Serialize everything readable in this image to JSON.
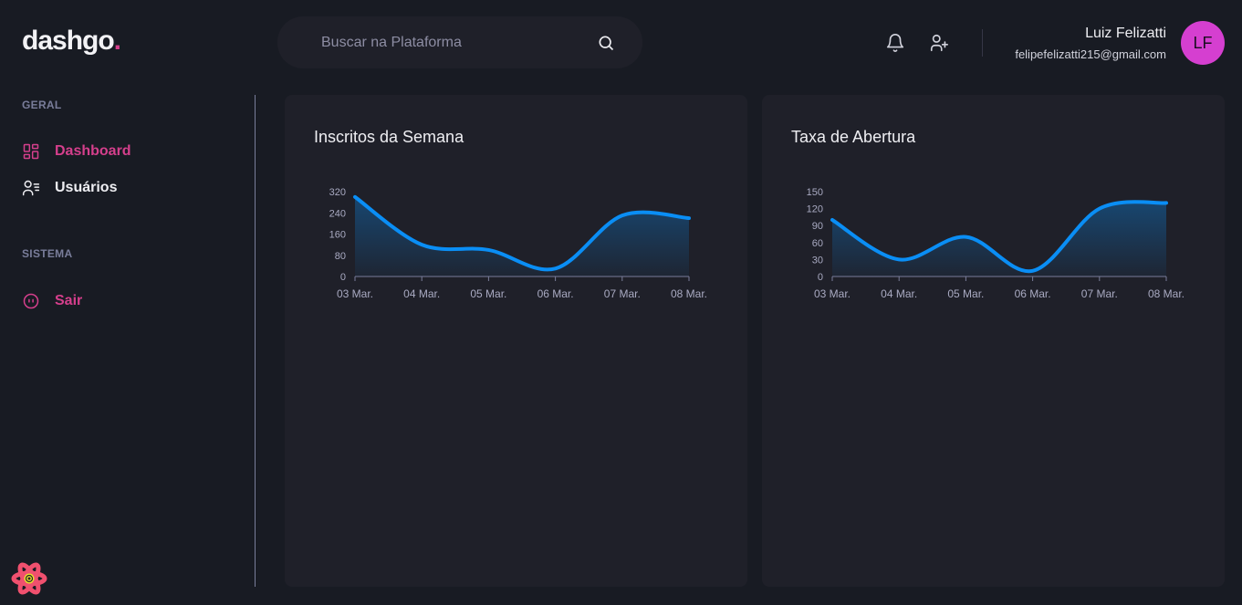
{
  "brand": {
    "name": "dashgo",
    "dot": "."
  },
  "search": {
    "placeholder": "Buscar na Plataforma"
  },
  "user": {
    "name": "Luiz Felizatti",
    "email": "felipefelizatti215@gmail.com",
    "initials": "LF"
  },
  "sidebar": {
    "sections": [
      {
        "title": "GERAL",
        "items": [
          {
            "label": "Dashboard",
            "icon": "dashboard-icon",
            "active": true
          },
          {
            "label": "Usuários",
            "icon": "users-icon",
            "active": false
          }
        ]
      },
      {
        "title": "SISTEMA",
        "items": [
          {
            "label": "Sair",
            "icon": "logout-icon",
            "active": true
          }
        ]
      }
    ]
  },
  "colors": {
    "accent": "#D53F8C",
    "line": "#0A8EF5",
    "background": "#181B23",
    "card": "#1F2029"
  },
  "cards": [
    {
      "title": "Inscritos da Semana"
    },
    {
      "title": "Taxa de Abertura"
    }
  ],
  "chart_data": [
    {
      "type": "area",
      "title": "Inscritos da Semana",
      "categories": [
        "03 Mar.",
        "04 Mar.",
        "05 Mar.",
        "06 Mar.",
        "07 Mar.",
        "08 Mar."
      ],
      "x": [
        "03 Mar.",
        "04 Mar.",
        "05 Mar.",
        "06 Mar.",
        "07 Mar.",
        "08 Mar."
      ],
      "values": [
        300,
        120,
        100,
        30,
        230,
        220
      ],
      "yticks": [
        0,
        80,
        160,
        240,
        320
      ],
      "ylim": [
        0,
        320
      ],
      "grid": false,
      "xlabel": "",
      "ylabel": ""
    },
    {
      "type": "area",
      "title": "Taxa de Abertura",
      "categories": [
        "03 Mar.",
        "04 Mar.",
        "05 Mar.",
        "06 Mar.",
        "07 Mar.",
        "08 Mar."
      ],
      "x": [
        "03 Mar.",
        "04 Mar.",
        "05 Mar.",
        "06 Mar.",
        "07 Mar.",
        "08 Mar."
      ],
      "values": [
        100,
        30,
        70,
        10,
        120,
        130
      ],
      "yticks": [
        0,
        30,
        60,
        90,
        120,
        150
      ],
      "ylim": [
        0,
        150
      ],
      "grid": false,
      "xlabel": "",
      "ylabel": ""
    }
  ]
}
